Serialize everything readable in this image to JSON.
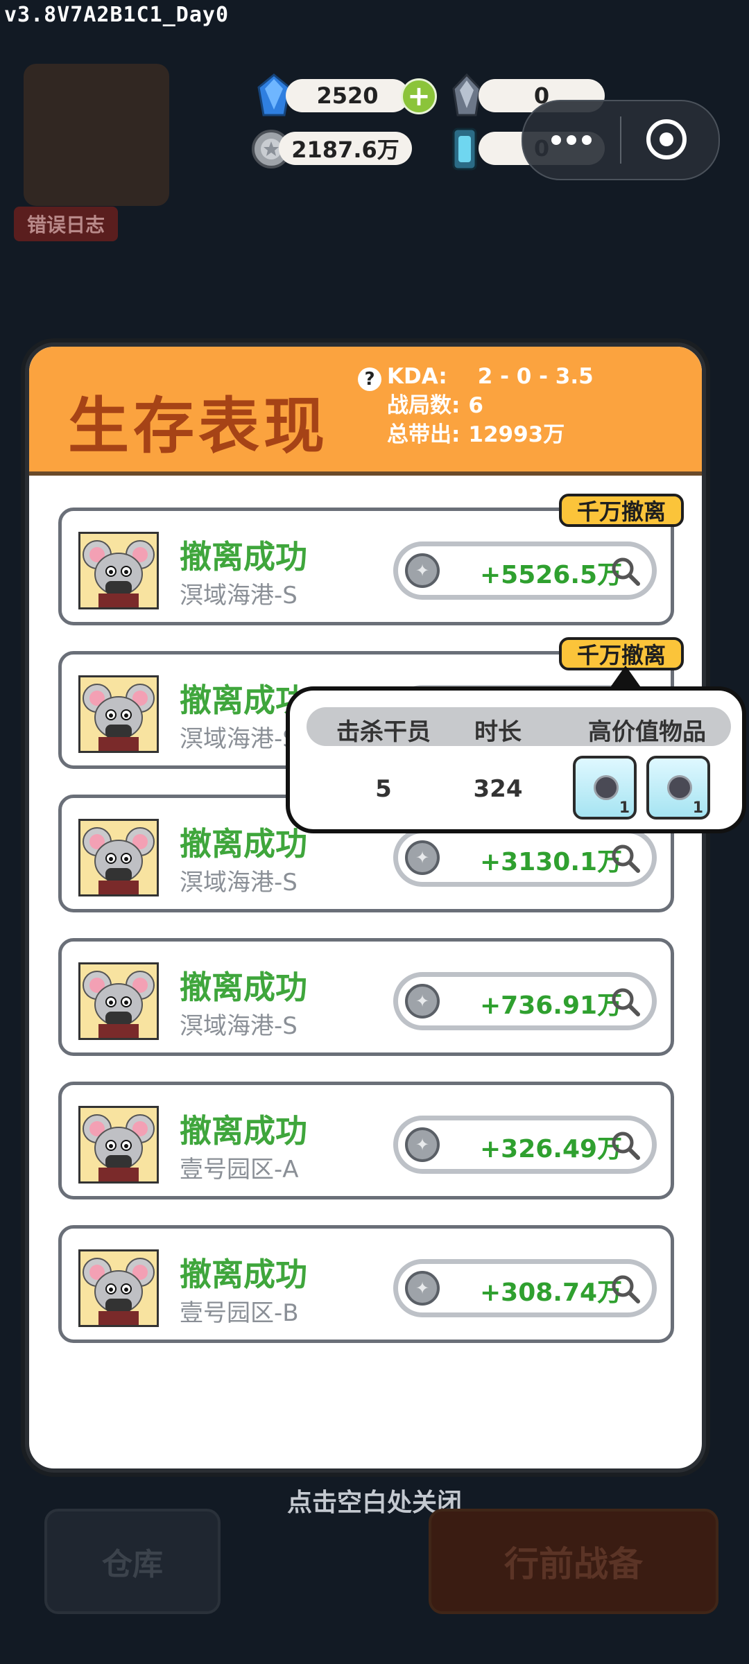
{
  "version": "v3.8V7A2B1C1_Day0",
  "currencies": {
    "gems": "2520",
    "shards": "0",
    "coins": "2187.6万",
    "crates": "0"
  },
  "background": {
    "error_log": "错误日志",
    "close_hint": "点击空白处关闭",
    "warehouse": "仓库",
    "prep": "行前战备"
  },
  "panel": {
    "title": "生存表现",
    "kda_label": "KDA:",
    "kda_value": "2 - 0 - 3.5",
    "matches_label": "战局数:",
    "matches_value": "6",
    "total_label": "总带出:",
    "total_value": "12993万"
  },
  "records": [
    {
      "status": "撤离成功",
      "map": "溟域海港-S",
      "value": "+5526.5万",
      "badge": "千万撤离"
    },
    {
      "status": "撤离成功",
      "map": "溟域海港-S",
      "value": "",
      "badge": "千万撤离"
    },
    {
      "status": "撤离成功",
      "map": "溟域海港-S",
      "value": "+3130.1万",
      "badge": ""
    },
    {
      "status": "撤离成功",
      "map": "溟域海港-S",
      "value": "+736.91万",
      "badge": ""
    },
    {
      "status": "撤离成功",
      "map": "壹号园区-A",
      "value": "+326.49万",
      "badge": ""
    },
    {
      "status": "撤离成功",
      "map": "壹号园区-B",
      "value": "+308.74万",
      "badge": ""
    }
  ],
  "popover": {
    "col_kills": "击杀干员",
    "col_duration": "时长",
    "col_items": "高价值物品",
    "kills": "5",
    "duration": "324",
    "item_counts": [
      "1",
      "1"
    ]
  },
  "colors": {
    "header_orange": "#fba33f",
    "title_brown": "#a64316",
    "success_green": "#3fa63c",
    "badge_yellow": "#fbc43a"
  }
}
